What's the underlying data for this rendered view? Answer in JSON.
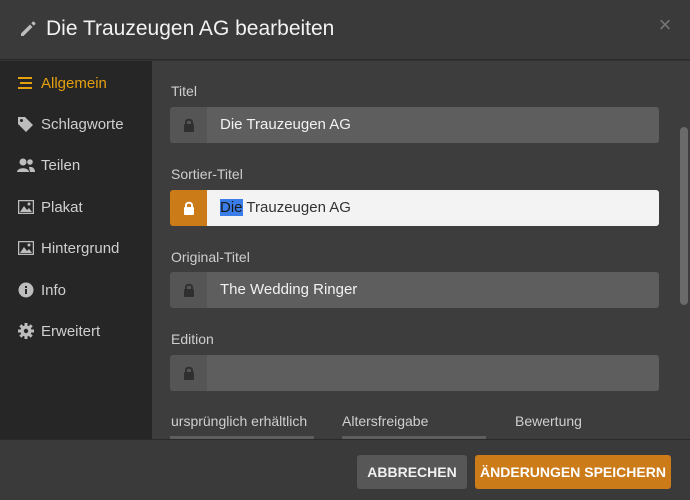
{
  "header": {
    "title": "Die Trauzeugen AG bearbeiten",
    "close_glyph": "×"
  },
  "sidebar": {
    "items": [
      {
        "label": "Allgemein",
        "icon": "list-icon"
      },
      {
        "label": "Schlagworte",
        "icon": "tag-icon"
      },
      {
        "label": "Teilen",
        "icon": "users-icon"
      },
      {
        "label": "Plakat",
        "icon": "image-icon"
      },
      {
        "label": "Hintergrund",
        "icon": "image-icon"
      },
      {
        "label": "Info",
        "icon": "info-icon"
      },
      {
        "label": "Erweitert",
        "icon": "gear-icon"
      }
    ],
    "active_index": 0
  },
  "form": {
    "title": {
      "label": "Titel",
      "value": "Die Trauzeugen AG"
    },
    "sort_title": {
      "label": "Sortier-Titel",
      "value_selected": "Die",
      "value_rest": " Trauzeugen AG"
    },
    "original_title": {
      "label": "Original-Titel",
      "value": "The Wedding Ringer"
    },
    "edition": {
      "label": "Edition",
      "value": ""
    },
    "available": {
      "label": "ursprünglich erhältlich"
    },
    "rating": {
      "label": "Altersfreigabe"
    },
    "score": {
      "label": "Bewertung"
    }
  },
  "footer": {
    "cancel_label": "ABBRECHEN",
    "save_label": "ÄNDERUNGEN SPEICHERN"
  },
  "colors": {
    "accent": "#cc7b19",
    "active_text": "#e5a00d",
    "selection": "#3b7de8"
  }
}
